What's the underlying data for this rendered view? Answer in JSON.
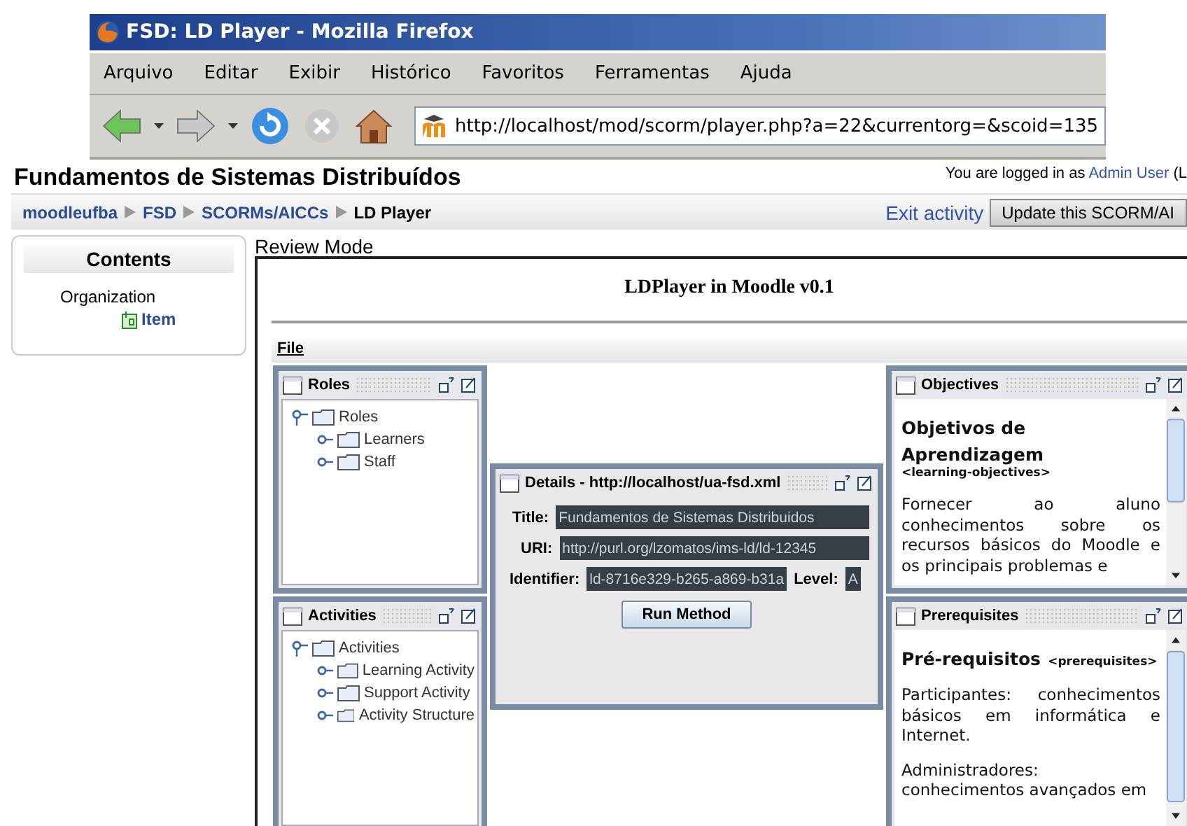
{
  "window": {
    "title": "FSD: LD Player - Mozilla Firefox"
  },
  "menu": [
    {
      "label": "Arquivo"
    },
    {
      "label": "Editar"
    },
    {
      "label": "Exibir"
    },
    {
      "label": "Histórico"
    },
    {
      "label": "Favoritos"
    },
    {
      "label": "Ferramentas"
    },
    {
      "label": "Ajuda"
    }
  ],
  "address": "http://localhost/mod/scorm/player.php?a=22&currentorg=&scoid=135",
  "page": {
    "heading": "Fundamentos de Sistemas Distribuídos",
    "login": {
      "prefix": "You are logged in as",
      "user": "Admin User",
      "suffix": "(L"
    },
    "breadcrumb": [
      {
        "label": "moodleufba",
        "link": true
      },
      {
        "label": "FSD",
        "link": true
      },
      {
        "label": "SCORMs/AICCs",
        "link": true
      },
      {
        "label": "LD Player",
        "link": false
      }
    ],
    "exit_link": "Exit activity",
    "update_button": "Update this SCORM/AI",
    "contents": {
      "title": "Contents",
      "organization": "Organization",
      "items": [
        {
          "label": "Item"
        }
      ]
    },
    "mode": "Review Mode"
  },
  "player": {
    "title": "LDPlayer in Moodle v0.1",
    "menu": [
      "File"
    ],
    "roles": {
      "title": "Roles",
      "tree": {
        "label": "Roles",
        "expanded": true,
        "children": [
          {
            "label": "Learners",
            "expanded": false
          },
          {
            "label": "Staff",
            "expanded": false
          }
        ]
      }
    },
    "activities": {
      "title": "Activities",
      "tree": {
        "label": "Activities",
        "expanded": true,
        "children": [
          {
            "label": "Learning Activity",
            "expanded": false
          },
          {
            "label": "Support Activity",
            "expanded": false
          },
          {
            "label": "Activity Structure",
            "expanded": false
          }
        ]
      }
    },
    "details": {
      "title": "Details - http://localhost/ua-fsd.xml",
      "fields": [
        {
          "label": "Title:",
          "value": "Fundamentos de Sistemas Distribuidos"
        },
        {
          "label": "URI:",
          "value": "http://purl.org/lzomatos/ims-ld/ld-12345"
        },
        {
          "label": "Identifier:",
          "value": "ld-8716e329-b265-a869-b31a"
        },
        {
          "label": "Level:",
          "value": "A"
        }
      ],
      "button": "Run Method"
    },
    "objectives": {
      "title": "Objectives",
      "heading": "Objetivos de Aprendizagem",
      "tag": "<learning-objectives>",
      "paragraphs": [
        "Fornecer ao aluno conhecimentos sobre os recursos básicos do Moodle e os principais problemas e"
      ]
    },
    "prerequisites": {
      "title": "Prerequisites",
      "heading": "Pré-requisitos",
      "tag": "<prerequisites>",
      "paragraphs": [
        "Participantes: conhecimentos básicos em informática e Internet.",
        "Administradores: conhecimentos avançados em"
      ]
    }
  }
}
